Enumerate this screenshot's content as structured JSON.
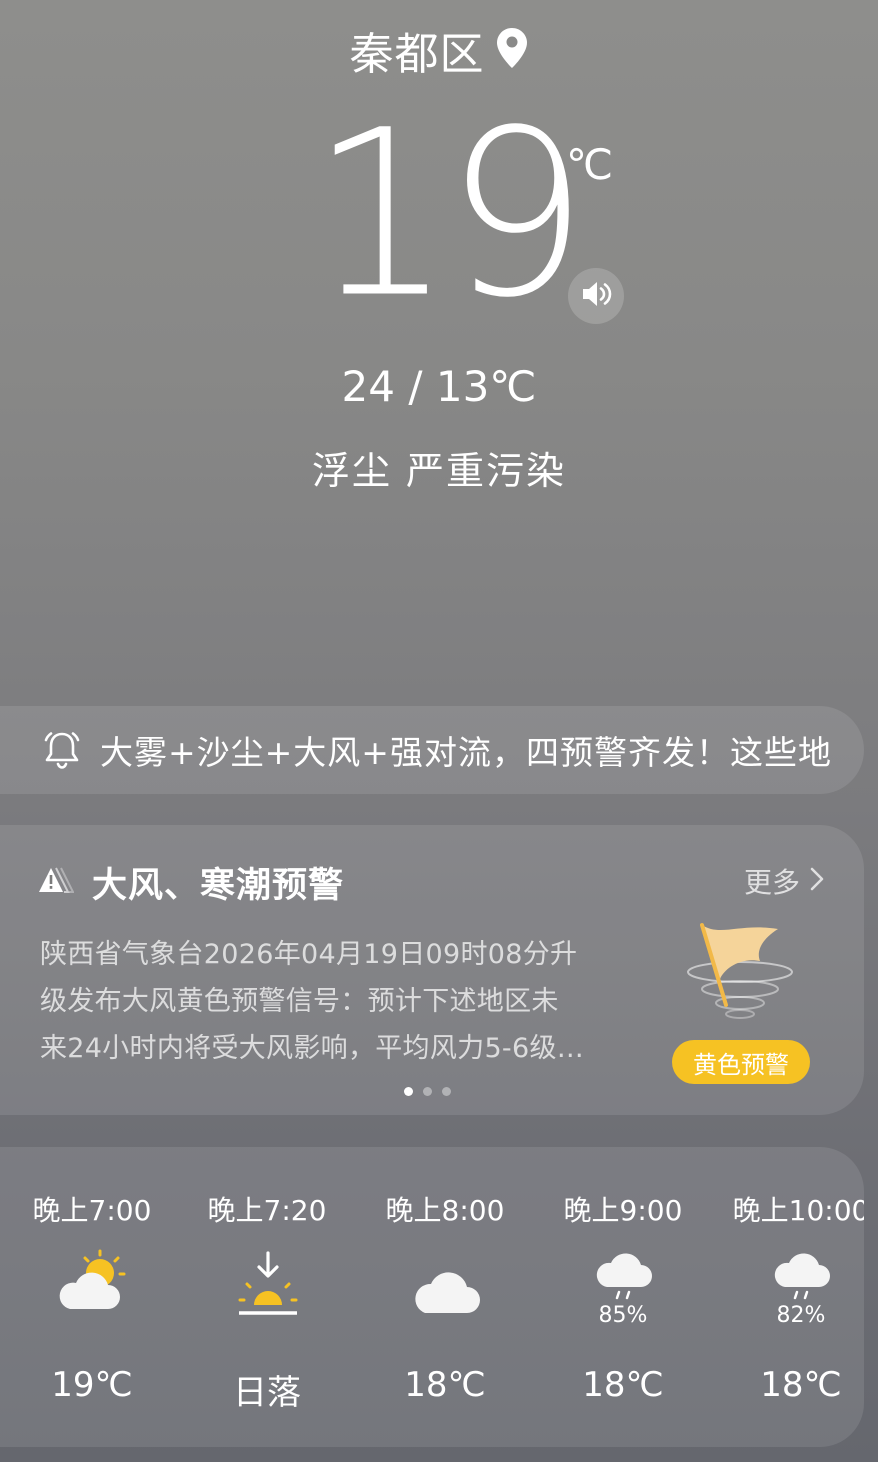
{
  "location": {
    "name": "秦都区",
    "icon": "location-pin-icon"
  },
  "current": {
    "temperature": "19",
    "unit": "℃",
    "range": "24 / 13℃",
    "air_quality": "浮尘  严重污染"
  },
  "notice": {
    "text": "大雾+沙尘+大风+强对流，四预警齐发！这些地",
    "icon": "bell-icon"
  },
  "warning": {
    "title": "大风、寒潮预警",
    "more": "更多",
    "lines": [
      "陕西省气象台2026年04月19日09时08分升",
      "级发布大风黄色预警信号：预计下述地区未",
      "来24小时内将受大风影响，平均风力5-6级…"
    ],
    "badge": "黄色预警",
    "badge_color": "#f6c223",
    "pages": 3,
    "active_page": 0
  },
  "hourly": [
    {
      "time": "晚上7:00",
      "icon": "partly-cloudy-sun-icon",
      "value": "19℃"
    },
    {
      "time": "晚上7:20",
      "icon": "sunset-icon",
      "value": "日落"
    },
    {
      "time": "晚上8:00",
      "icon": "cloudy-icon",
      "value": "18℃"
    },
    {
      "time": "晚上9:00",
      "icon": "rain-icon",
      "precip": "85%",
      "value": "18℃"
    },
    {
      "time": "晚上10:00",
      "icon": "rain-icon",
      "precip": "82%",
      "value": "18℃"
    }
  ]
}
